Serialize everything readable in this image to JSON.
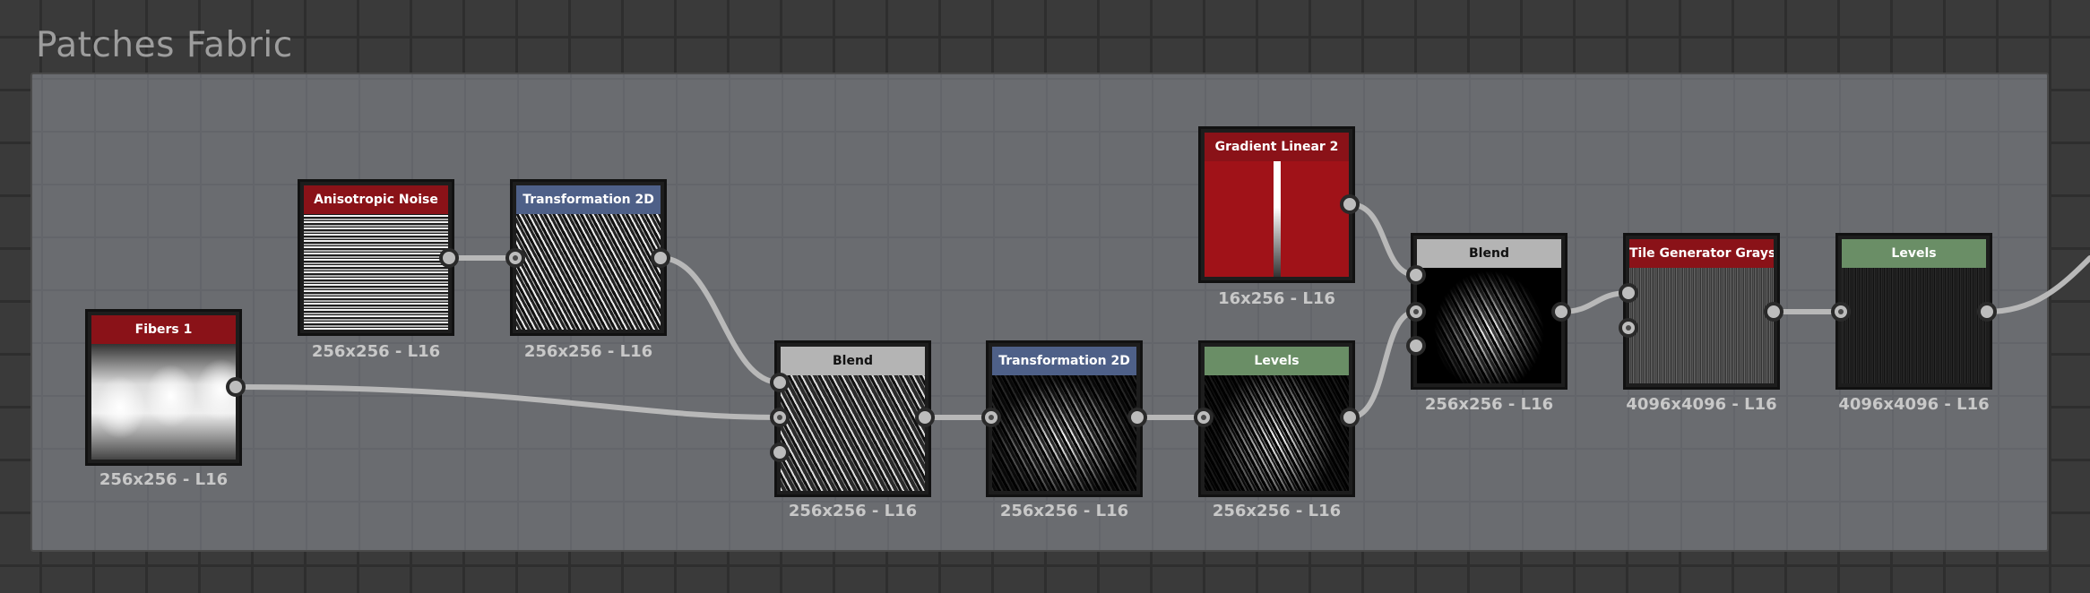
{
  "frame": {
    "title": "Patches Fabric"
  },
  "nodes": {
    "fibers": {
      "title": "Fibers 1",
      "res": "256x256 - L16"
    },
    "aniso": {
      "title": "Anisotropic Noise",
      "res": "256x256 - L16"
    },
    "transform1": {
      "title": "Transformation 2D",
      "res": "256x256 - L16"
    },
    "blend1": {
      "title": "Blend",
      "res": "256x256 - L16"
    },
    "transform2": {
      "title": "Transformation 2D",
      "res": "256x256 - L16"
    },
    "levels1": {
      "title": "Levels",
      "res": "256x256 - L16"
    },
    "gradient": {
      "title": "Gradient Linear 2",
      "res": "16x256 - L16"
    },
    "blend2": {
      "title": "Blend",
      "res": "256x256 - L16"
    },
    "tilegen": {
      "title": "Tile Generator Grayscale",
      "res": "4096x4096 - L16"
    },
    "levels2": {
      "title": "Levels",
      "res": "4096x4096 - L16"
    }
  },
  "colors": {
    "header_red": "#8a1218",
    "header_blue": "#4e6088",
    "header_gray": "#b4b4b4",
    "header_green": "#6a8e66",
    "wire": "#b8b8b8"
  }
}
